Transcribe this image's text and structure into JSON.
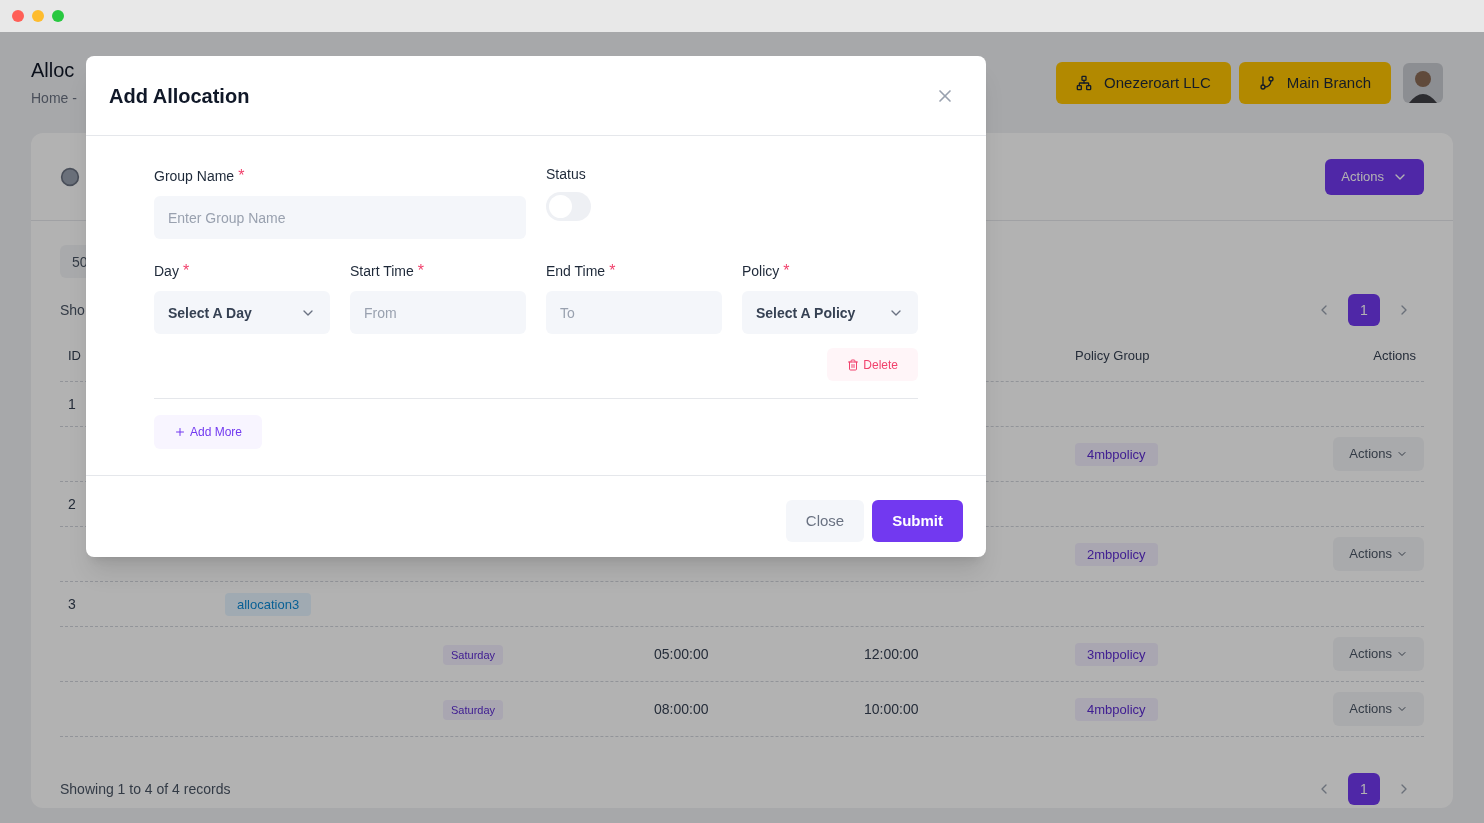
{
  "page": {
    "title": "Alloc",
    "breadcrumb": "Home  -",
    "org_button": "Onezeroart LLC",
    "branch_button": "Main Branch",
    "actions_button": "Actions",
    "page_size": "50",
    "showing_top": "Sho",
    "pagination_top": [
      {
        "label": "1",
        "selected": true
      }
    ],
    "table": {
      "columns": [
        "ID",
        null,
        null,
        null,
        null,
        "Policy Group",
        "Actions"
      ],
      "groups": [
        {
          "id": "1",
          "entries": [
            {
              "policy": "4mbpolicy",
              "action": "Actions"
            }
          ]
        },
        {
          "id": "2",
          "entries": [
            {
              "policy": "2mbpolicy",
              "action": "Actions"
            }
          ]
        },
        {
          "id": "3",
          "name": "allocation3",
          "entries": [
            {
              "day": "Saturday",
              "start": "05:00:00",
              "end": "12:00:00",
              "policy": "3mbpolicy",
              "action": "Actions"
            },
            {
              "day": "Saturday",
              "start": "08:00:00",
              "end": "10:00:00",
              "policy": "4mbpolicy",
              "action": "Actions"
            }
          ]
        }
      ]
    },
    "footer": "Showing 1 to 4 of 4 records",
    "pagination_bottom": [
      {
        "label": "1",
        "selected": true
      }
    ]
  },
  "modal": {
    "title": "Add Allocation",
    "group_name": {
      "label": "Group Name",
      "required_mark": "*",
      "placeholder": "Enter Group Name"
    },
    "status": {
      "label": "Status",
      "on": false
    },
    "fields": [
      {
        "kind": "select",
        "label": "Day",
        "required_mark": "*",
        "value": "Select A Day"
      },
      {
        "kind": "input",
        "label": "Start Time",
        "required_mark": "*",
        "placeholder": "From"
      },
      {
        "kind": "input",
        "label": "End Time",
        "required_mark": "*",
        "placeholder": "To"
      },
      {
        "kind": "select",
        "label": "Policy",
        "required_mark": "*",
        "value": "Select A Policy"
      }
    ],
    "delete_button": "Delete",
    "add_more_button": "Add More",
    "close_button": "Close",
    "submit_button": "Submit"
  }
}
